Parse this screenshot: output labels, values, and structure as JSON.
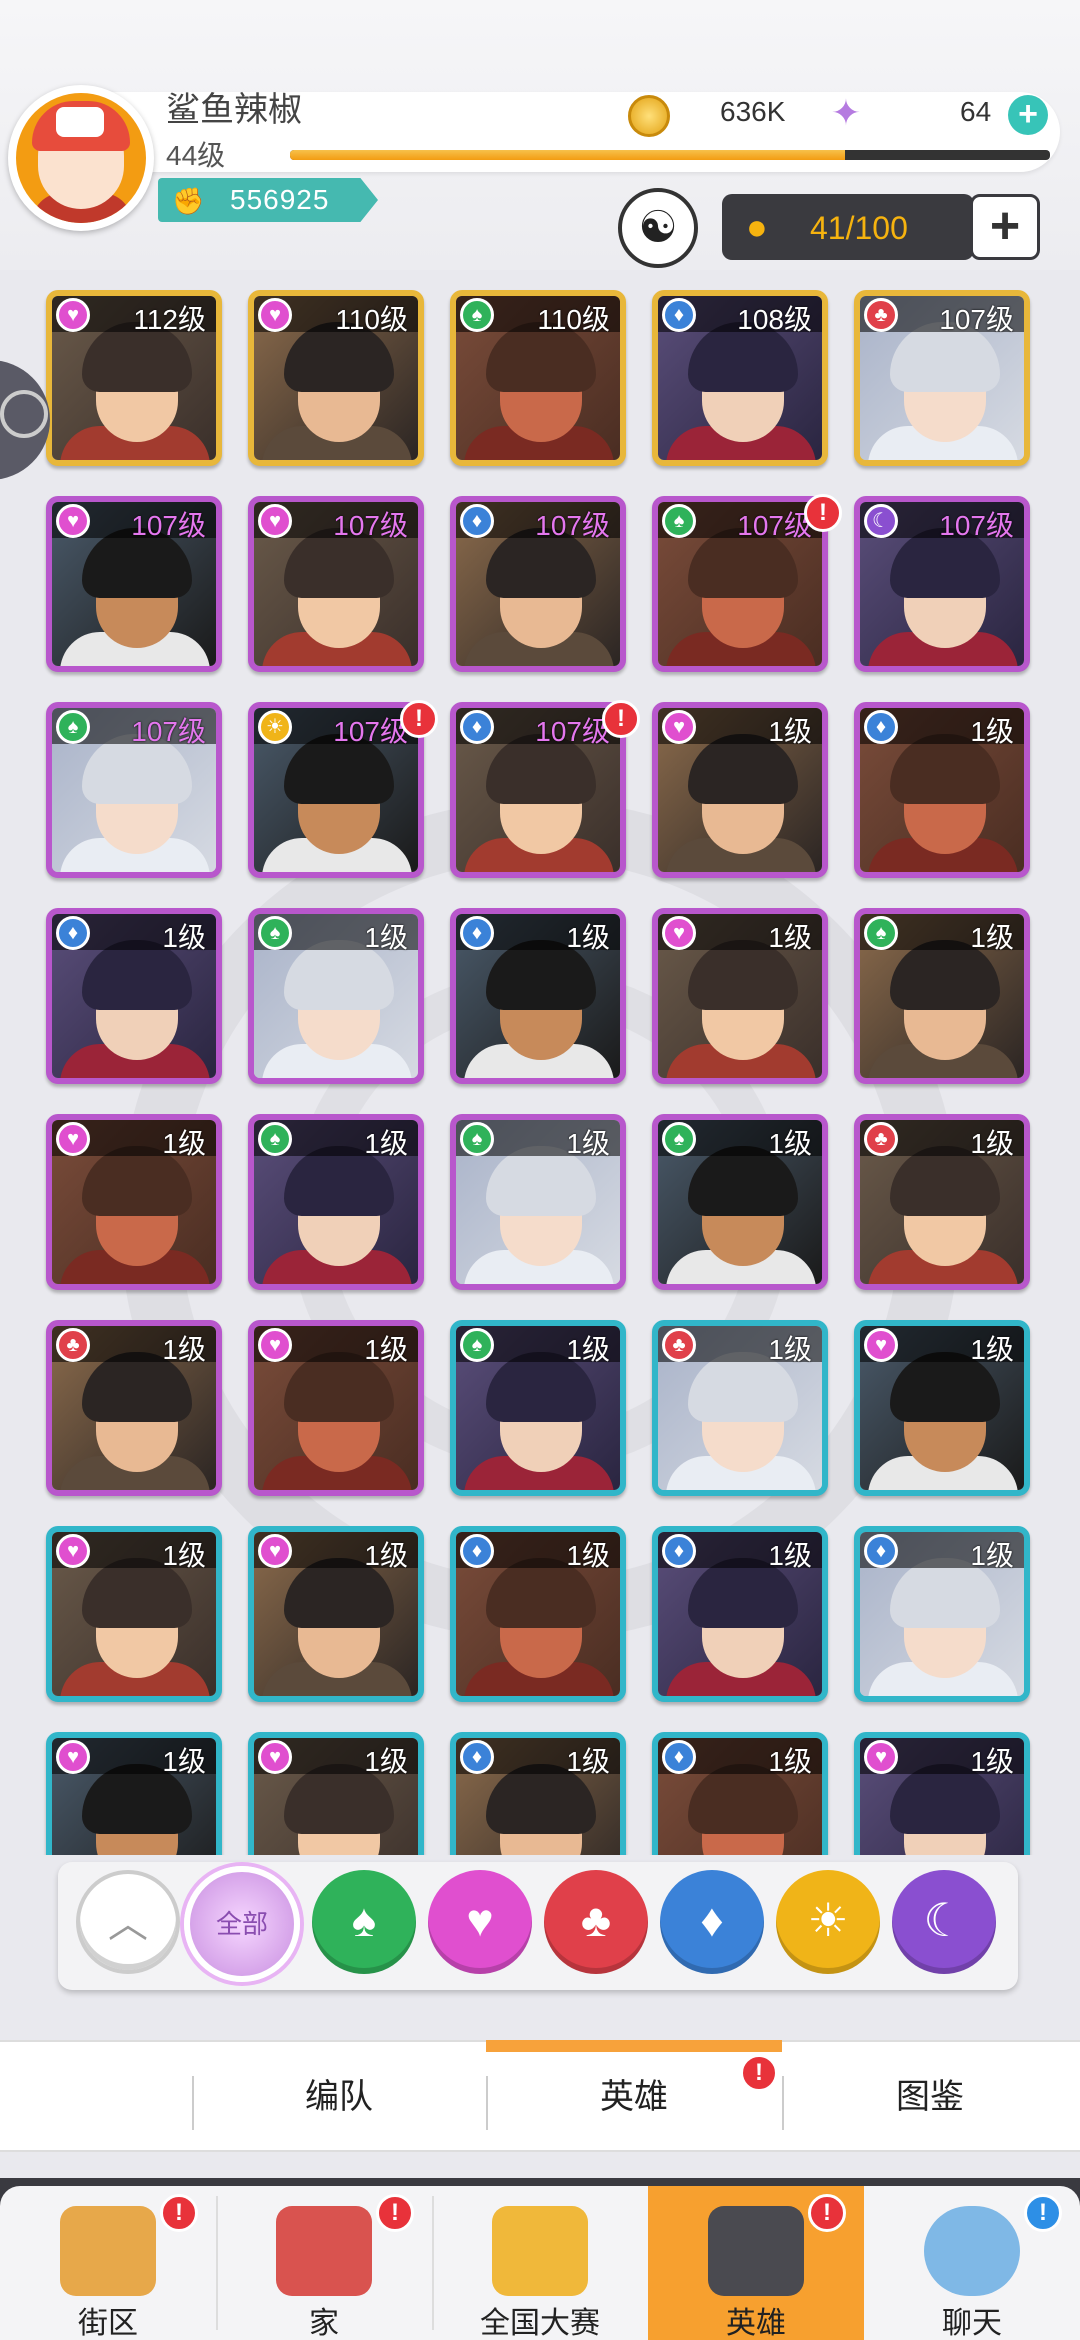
{
  "profile": {
    "name": "鲨鱼辣椒",
    "level": "44级",
    "power": "556925",
    "xp_fraction": 0.73
  },
  "currency": {
    "coins": "636K",
    "gems": "64"
  },
  "roster": {
    "count": "41/100"
  },
  "colors": {
    "accent": "#f7a23b",
    "gold": "#e8b73a",
    "purple": "#b857cc",
    "teal": "#31b6c9"
  },
  "heroes": [
    {
      "level": "112级",
      "suit": "heart",
      "frame": "gold"
    },
    {
      "level": "110级",
      "suit": "heart",
      "frame": "gold"
    },
    {
      "level": "110级",
      "suit": "spade",
      "frame": "gold"
    },
    {
      "level": "108级",
      "suit": "diamond",
      "frame": "gold"
    },
    {
      "level": "107级",
      "suit": "club",
      "frame": "gold"
    },
    {
      "level": "107级",
      "suit": "heart",
      "frame": "purple"
    },
    {
      "level": "107级",
      "suit": "heart",
      "frame": "purple"
    },
    {
      "level": "107级",
      "suit": "diamond",
      "frame": "purple"
    },
    {
      "level": "107级",
      "suit": "spade",
      "frame": "purple",
      "alert": true
    },
    {
      "level": "107级",
      "suit": "moon",
      "frame": "purple"
    },
    {
      "level": "107级",
      "suit": "spade",
      "frame": "purple"
    },
    {
      "level": "107级",
      "suit": "sun",
      "frame": "purple",
      "alert": true
    },
    {
      "level": "107级",
      "suit": "diamond",
      "frame": "purple",
      "alert": true
    },
    {
      "level": "1级",
      "suit": "heart",
      "frame": "purple"
    },
    {
      "level": "1级",
      "suit": "diamond",
      "frame": "purple"
    },
    {
      "level": "1级",
      "suit": "diamond",
      "frame": "purple"
    },
    {
      "level": "1级",
      "suit": "spade",
      "frame": "purple"
    },
    {
      "level": "1级",
      "suit": "diamond",
      "frame": "purple"
    },
    {
      "level": "1级",
      "suit": "heart",
      "frame": "purple"
    },
    {
      "level": "1级",
      "suit": "spade",
      "frame": "purple"
    },
    {
      "level": "1级",
      "suit": "heart",
      "frame": "purple"
    },
    {
      "level": "1级",
      "suit": "spade",
      "frame": "purple"
    },
    {
      "level": "1级",
      "suit": "spade",
      "frame": "purple"
    },
    {
      "level": "1级",
      "suit": "spade",
      "frame": "purple"
    },
    {
      "level": "1级",
      "suit": "club",
      "frame": "purple"
    },
    {
      "level": "1级",
      "suit": "club",
      "frame": "purple"
    },
    {
      "level": "1级",
      "suit": "heart",
      "frame": "purple"
    },
    {
      "level": "1级",
      "suit": "spade",
      "frame": "teal"
    },
    {
      "level": "1级",
      "suit": "club",
      "frame": "teal"
    },
    {
      "level": "1级",
      "suit": "heart",
      "frame": "teal"
    },
    {
      "level": "1级",
      "suit": "heart",
      "frame": "teal"
    },
    {
      "level": "1级",
      "suit": "heart",
      "frame": "teal"
    },
    {
      "level": "1级",
      "suit": "diamond",
      "frame": "teal"
    },
    {
      "level": "1级",
      "suit": "diamond",
      "frame": "teal"
    },
    {
      "level": "1级",
      "suit": "diamond",
      "frame": "teal"
    },
    {
      "level": "1级",
      "suit": "heart",
      "frame": "teal"
    },
    {
      "level": "1级",
      "suit": "heart",
      "frame": "teal"
    },
    {
      "level": "1级",
      "suit": "diamond",
      "frame": "teal"
    },
    {
      "level": "1级",
      "suit": "diamond",
      "frame": "teal"
    },
    {
      "level": "1级",
      "suit": "heart",
      "frame": "teal"
    }
  ],
  "filters": {
    "all_label": "全部",
    "icons": [
      "collapse-icon",
      "all-icon",
      "spade-icon",
      "heart-icon",
      "club-icon",
      "diamond-icon",
      "sun-icon",
      "moon-icon"
    ]
  },
  "tabs": [
    {
      "label": "编队"
    },
    {
      "label": "英雄",
      "active": true,
      "alert": "!"
    },
    {
      "label": "图鉴"
    }
  ],
  "nav": [
    {
      "label": "街区",
      "icon": "signpost-icon",
      "badge": "!"
    },
    {
      "label": "家",
      "icon": "house-icon",
      "badge": "!"
    },
    {
      "label": "全国大赛",
      "icon": "trophy-icon"
    },
    {
      "label": "英雄",
      "icon": "cards-icon",
      "badge": "!",
      "active": true
    },
    {
      "label": "聊天",
      "icon": "chat-icon",
      "badge": "!"
    }
  ]
}
